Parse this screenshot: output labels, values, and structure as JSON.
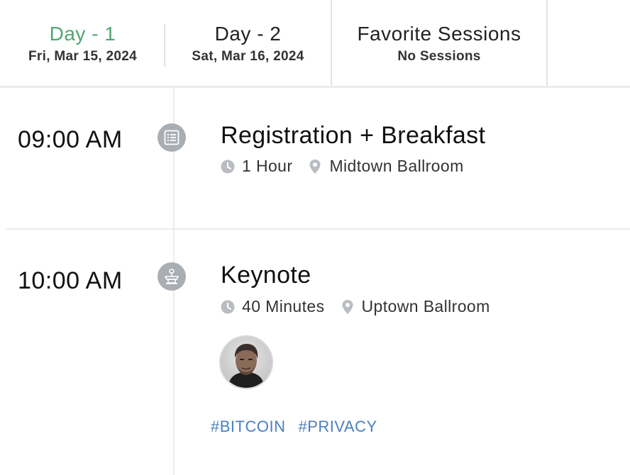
{
  "tabs": [
    {
      "title": "Day - 1",
      "subtitle": "Fri, Mar 15, 2024"
    },
    {
      "title": "Day - 2",
      "subtitle": "Sat, Mar 16, 2024"
    },
    {
      "title": "Favorite Sessions",
      "subtitle": "No Sessions"
    }
  ],
  "colors": {
    "active_tab": "#4fa672",
    "tag": "#4a7fc1",
    "icon_bg": "#a9aeb4"
  },
  "sessions": [
    {
      "time": "09:00 AM",
      "type_icon": "list-icon",
      "title": "Registration + Breakfast",
      "duration": "1 Hour",
      "location": "Midtown Ballroom"
    },
    {
      "time": "10:00 AM",
      "type_icon": "podium-icon",
      "title": "Keynote",
      "duration": "40 Minutes",
      "location": "Uptown Ballroom",
      "tags": [
        "#BITCOIN",
        "#PRIVACY"
      ]
    }
  ]
}
